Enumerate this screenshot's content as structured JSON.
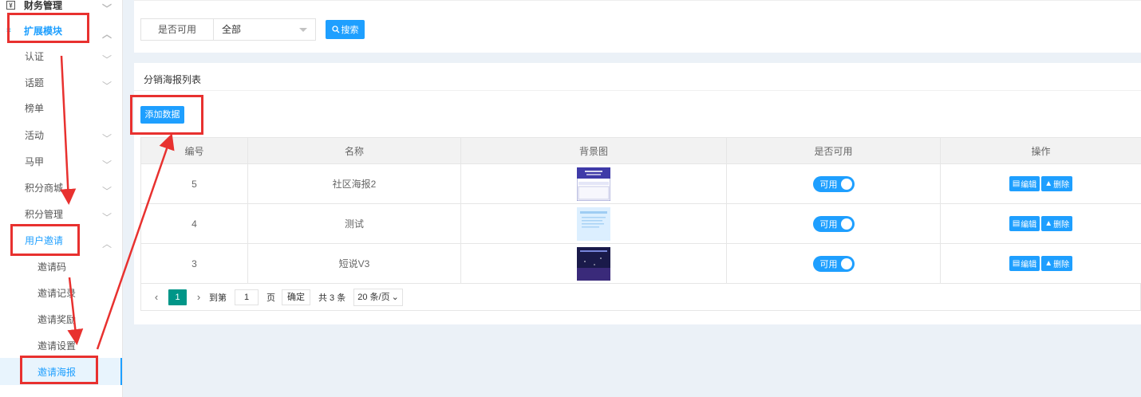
{
  "sidebar": {
    "finance": "财务管理",
    "extend": "扩展模块",
    "items": [
      {
        "label": "认证"
      },
      {
        "label": "话题"
      },
      {
        "label": "榜单"
      },
      {
        "label": "活动"
      },
      {
        "label": "马甲"
      },
      {
        "label": "积分商城"
      },
      {
        "label": "积分管理"
      },
      {
        "label": "用户邀请"
      }
    ],
    "sub_items": [
      {
        "label": "邀请码"
      },
      {
        "label": "邀请记录"
      },
      {
        "label": "邀请奖励"
      },
      {
        "label": "邀请设置"
      },
      {
        "label": "邀请海报"
      }
    ]
  },
  "filter": {
    "label": "是否可用",
    "value": "全部",
    "search_label": "搜索"
  },
  "list": {
    "title": "分销海报列表",
    "add_label": "添加数据",
    "columns": [
      "编号",
      "名称",
      "背景图",
      "是否可用",
      "操作"
    ],
    "rows": [
      {
        "id": "5",
        "name": "社区海报2",
        "status": "可用"
      },
      {
        "id": "4",
        "name": "测试",
        "status": "可用"
      },
      {
        "id": "3",
        "name": "短说V3",
        "status": "可用"
      }
    ],
    "edit_label": "编辑",
    "delete_label": "删除"
  },
  "pager": {
    "current": "1",
    "goto_label": "到第",
    "page_input": "1",
    "page_unit": "页",
    "confirm": "确定",
    "total": "共 3 条",
    "page_size": "20 条/页"
  },
  "colors": {
    "accent": "#1e9fff",
    "pager_active": "#009688",
    "annotation": "#e8312f"
  }
}
